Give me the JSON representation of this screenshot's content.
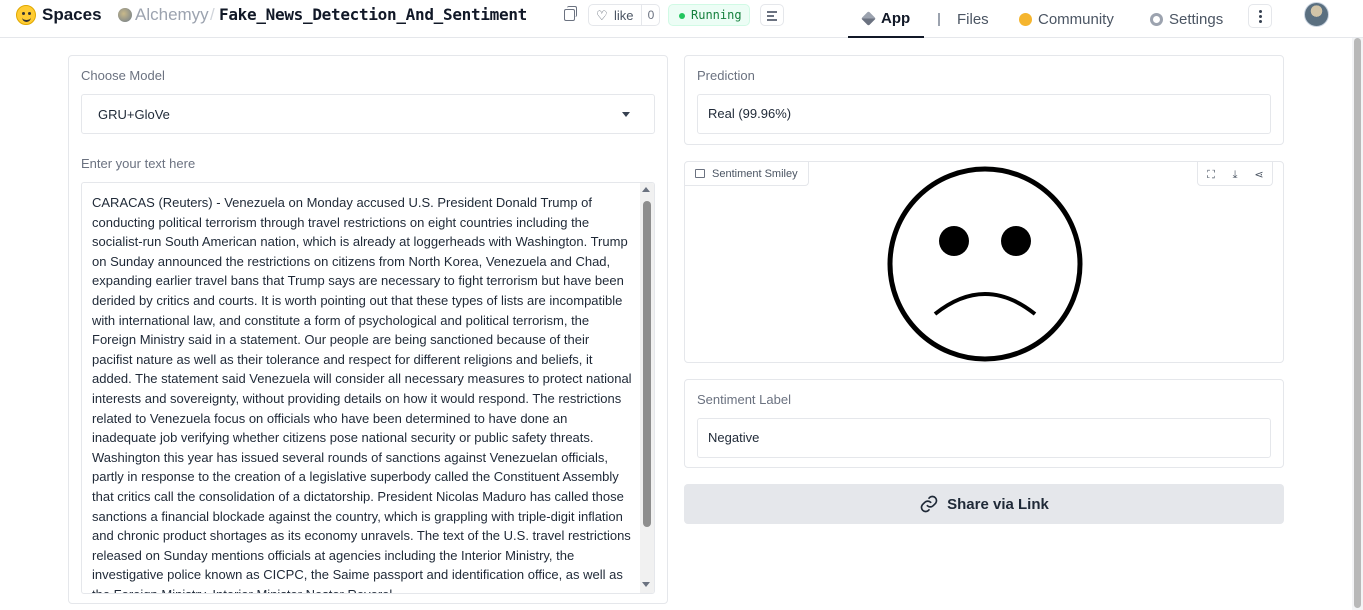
{
  "header": {
    "brand": "Spaces",
    "owner": "Alchemyy",
    "separator": "/",
    "repo": "Fake_News_Detection_And_Sentiment",
    "like_label": "like",
    "like_count": "0",
    "status": "Running",
    "tabs": [
      {
        "label": "App",
        "icon": "cube-icon",
        "active": true
      },
      {
        "label": "Files",
        "icon": "files-icon"
      },
      {
        "label": "Community",
        "icon": "community-icon"
      },
      {
        "label": "Settings",
        "icon": "gear-icon"
      }
    ]
  },
  "left": {
    "model_label": "Choose Model",
    "model_value": "GRU+GloVe",
    "text_label": "Enter your text here",
    "text_value": "CARACAS (Reuters) - Venezuela on Monday accused U.S. President Donald Trump of conducting political terrorism through travel restrictions on eight countries including the socialist-run South American nation, which is already at loggerheads with Washington. Trump on Sunday announced the restrictions on citizens from North Korea, Venezuela and Chad, expanding earlier travel bans that Trump says are necessary to fight terrorism but have been derided by critics and courts. It is worth pointing out that these types of lists are incompatible with international law, and constitute a form of psychological and political terrorism, the Foreign Ministry said in a statement. Our people are being sanctioned because of their pacifist nature as well as their tolerance and respect for different religions and beliefs, it added. The statement said Venezuela will consider all necessary measures to protect national interests and sovereignty, without providing details on how it would respond. The restrictions related to Venezuela focus on officials who have been determined to have done an inadequate job verifying whether citizens pose national security or public safety threats. Washington this year has issued several rounds of sanctions against Venezuelan officials, partly in response to the creation of a legislative superbody called the Constituent Assembly that critics call the consolidation of a dictatorship. President Nicolas Maduro has called those sanctions a financial blockade against the country, which is grappling with triple-digit inflation and chronic product shortages as its economy unravels. The text of the U.S. travel restrictions released on Sunday mentions officials at agencies including the Interior Ministry, the investigative police known as CICPC, the Saime passport and identification office, as well as the Foreign Ministry. Interior Minister Nestor Reverol"
  },
  "prediction": {
    "label": "Prediction",
    "value": "Real (99.96%)"
  },
  "smiley": {
    "label": "Sentiment Smiley",
    "expression": "sad"
  },
  "sentiment": {
    "label": "Sentiment Label",
    "value": "Negative"
  },
  "share": {
    "label": "Share via Link"
  }
}
